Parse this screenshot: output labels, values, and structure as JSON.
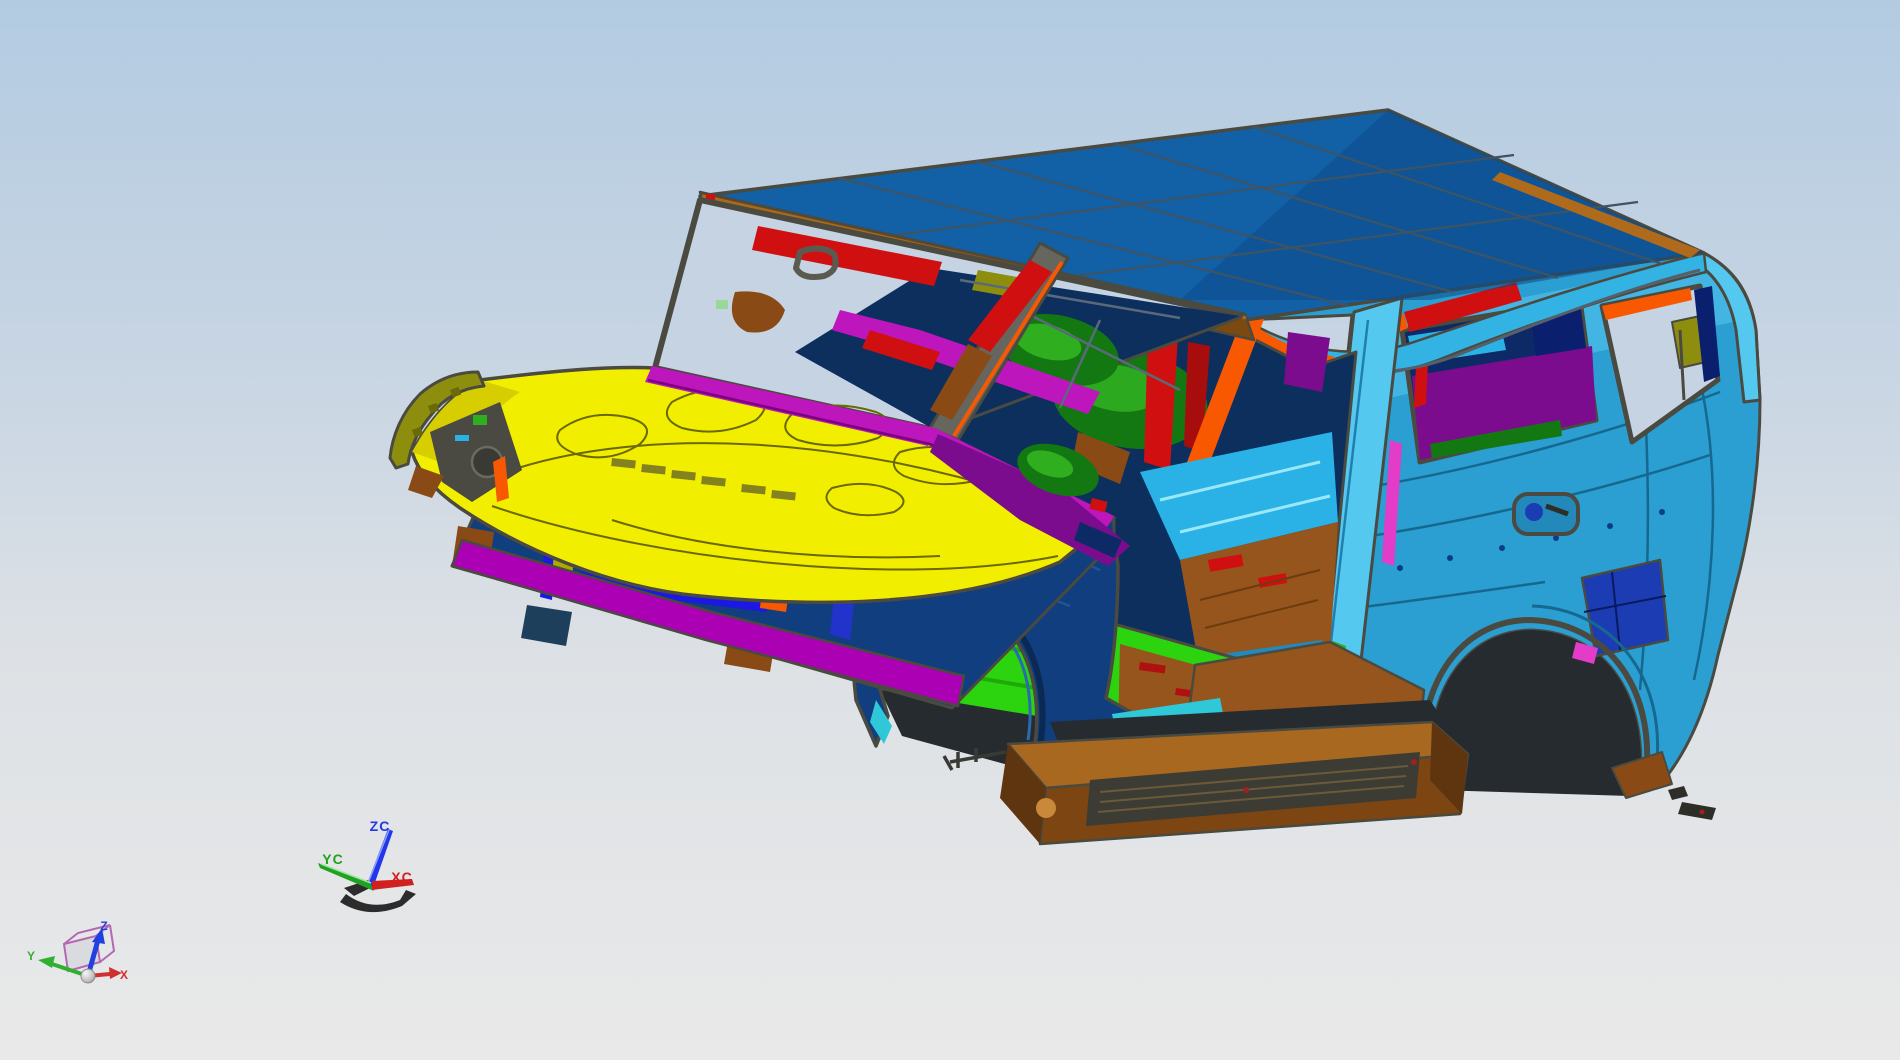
{
  "viewport": {
    "kind": "cad-3d-viewport",
    "model": "suv-body-in-white-assembly"
  },
  "background": {
    "top": "#b3cbe2",
    "upper_mid": "#c8d5e3",
    "lower_mid": "#dde1e5",
    "bottom": "#e9e9e9"
  },
  "palette": {
    "outline": "#4a4a40",
    "roof_blue": "#1260a6",
    "roof_blue_dark": "#0b4a88",
    "roof_seam": "#3e5464",
    "rail_brown": "#7c4a10",
    "rail_copper": "#b06a1c",
    "cant_cyan": "#33b2e4",
    "teal_body": "#2b9ed2",
    "teal_light": "#55c8f0",
    "teal_mid": "#2389ba",
    "teal_dark": "#16688f",
    "orange": "#f85800",
    "red": "#d01010",
    "hood_yellow": "#f2ee00",
    "hood_shade": "#d6ce00",
    "hood_line": "#6a6800",
    "fender_navy": "#113e7e",
    "fender_highlight": "#2a6ab2",
    "navy_panel": "#0d2a66",
    "navy_interior": "#0c2f5e",
    "grille_blue": "#1a18e2",
    "grille_blue_dark": "#2a2ac2",
    "magenta": "#ac00b4",
    "cowl_magenta": "#bc16bc",
    "pink": "#e23cc8",
    "purple": "#7c0c8e",
    "green_bright": "#2cd410",
    "green_dark": "#147812",
    "green_mid": "#2fae20",
    "cyan_floor": "#2ab2e6",
    "cyan_sill": "#2fc8d8",
    "brown_floor": "#96551c",
    "board_top": "#a86820",
    "board_face": "#7c4512",
    "board_dark": "#5e350e",
    "board_highlight": "#c8893a",
    "tread_dark": "#3c3c34",
    "shadow_dark": "#262b30",
    "blue_pocket": "#1c3cb4",
    "olive": "#8e8e0e",
    "window_bg": "#c6d3e3",
    "gray_frame": "#66665e",
    "copper": "#8a4a16",
    "dark_part": "#2e2e28",
    "fastener_gray": "#c9c9c4"
  },
  "wcs_triad": {
    "x_label": "XC",
    "y_label": "YC",
    "z_label": "ZC",
    "x_color": "#d02020",
    "y_color": "#22a022",
    "z_color": "#2238e8",
    "handle_color": "#2c2c2c"
  },
  "view_triad": {
    "x_label": "X",
    "y_label": "Y",
    "z_label": "Z",
    "x_color": "#d03030",
    "y_color": "#30b030",
    "z_color": "#2040e0",
    "cube_color": "#b468b4",
    "ball_color": "#d0d0d0"
  }
}
